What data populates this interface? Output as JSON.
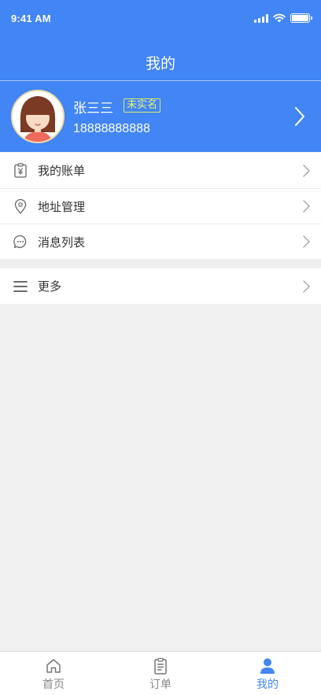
{
  "status_bar": {
    "time": "9:41 AM"
  },
  "header": {
    "title": "我的"
  },
  "profile": {
    "name": "张三三",
    "badge": "未实名",
    "phone": "18888888888"
  },
  "menu": {
    "items": [
      {
        "label": "我的账单",
        "icon": "bill-icon"
      },
      {
        "label": "地址管理",
        "icon": "location-pin-icon"
      },
      {
        "label": "消息列表",
        "icon": "chat-bubble-icon"
      }
    ],
    "more": {
      "label": "更多",
      "icon": "hamburger-menu-icon"
    }
  },
  "tabbar": {
    "tabs": [
      {
        "label": "首页",
        "icon": "home-icon",
        "active": false
      },
      {
        "label": "订单",
        "icon": "clipboard-icon",
        "active": false
      },
      {
        "label": "我的",
        "icon": "user-icon",
        "active": true
      }
    ]
  },
  "colors": {
    "accent": "#4285f4",
    "badge": "#e6f07a",
    "background": "#f0f0f0"
  }
}
